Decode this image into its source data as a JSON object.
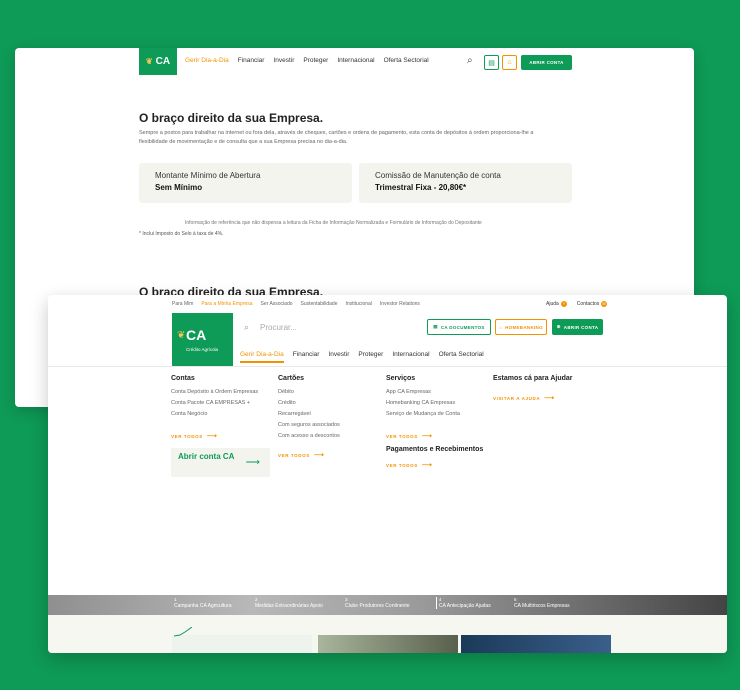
{
  "brand": {
    "logo_text": "CA",
    "logo_sub": "Crédito Agrícola",
    "green": "#0e9a57",
    "orange": "#f39200"
  },
  "back": {
    "menu": [
      "Gerir Dia-a-Dia",
      "Financiar",
      "Investir",
      "Proteger",
      "Internacional",
      "Oferta Sectorial"
    ],
    "open_account": "ABRIR CONTA",
    "title": "O braço direito da sua Empresa.",
    "paragraph": "Sempre a postos para trabalhar na internet ou fora dela, através de cheques, cartões e ordens de pagamento, esta conta de depósitos à ordem proporciona-lhe a flexibilidade de movimentação e de consulta que a sua Empresa precisa no dia-a-dia.",
    "box1": {
      "label": "Montante Mínimo de Abertura",
      "value": "Sem Mínimo"
    },
    "box2": {
      "label": "Comissão de Manutenção de conta",
      "value": "Trimestral Fixa - 20,80€*"
    },
    "info": "Informação de referência que não dispensa a leitura da Ficha de Informação Normalizada e Formulário de Informação do Depositante",
    "note": "* Inclui Imposto do Selo à taxa de 4%.",
    "title2": "O braço direito da sua Empresa."
  },
  "front": {
    "top_links": [
      "Para Mim",
      "Para a Minha Empresa",
      "Ser Associado",
      "Sustentabilidade",
      "Institucional",
      "Investor Relations"
    ],
    "help": "Ajuda",
    "contacts": "Contactos",
    "search_placeholder": "Procurar...",
    "btn_docs": "CA DOCUMENTOS",
    "btn_home": "HOMEBANKING",
    "btn_open": "ABRIR CONTA",
    "menu": [
      "Gerir Dia-a-Dia",
      "Financiar",
      "Investir",
      "Proteger",
      "Internacional",
      "Oferta Sectorial"
    ],
    "col1": {
      "title": "Contas",
      "items": [
        "Conta Depósito à Ordem Empresas",
        "Conta Pacote CA EMPRESAS +",
        "Conta Negócio"
      ],
      "see_all": "VER TODOS"
    },
    "col2": {
      "title": "Cartões",
      "items": [
        "Débito",
        "Crédito",
        "Recarregável",
        "Com seguros associados",
        "Com acesso a descontos"
      ],
      "see_all": "VER TODOS"
    },
    "col3": {
      "title": "Serviços",
      "items": [
        "App CA Empresas",
        "Homebanking CA Empresas",
        "Serviço de Mudança de Conta"
      ],
      "see_all": "VER TODOS",
      "title2": "Pagamentos e Recebimentos",
      "see_all2": "VER TODOS"
    },
    "col4": {
      "title": "Estamos cá para Ajudar",
      "link": "VISITAR A AJUDA"
    },
    "open_box": "Abrir conta CA",
    "slides": [
      {
        "n": "1",
        "label": "Campanha CA Agricultura"
      },
      {
        "n": "2",
        "label": "Medidas Extraordinárias Apoio"
      },
      {
        "n": "3",
        "label": "Clube Produtores Continente"
      },
      {
        "n": "4",
        "label": "CA Antecipação Ajudas"
      },
      {
        "n": "5",
        "label": "CA Multiriscos Empresas"
      }
    ]
  }
}
